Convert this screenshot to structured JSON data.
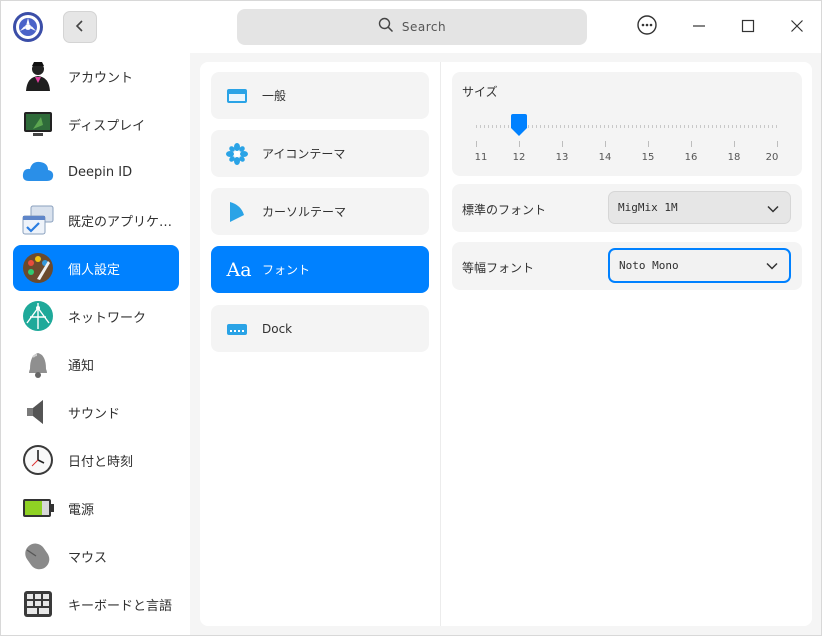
{
  "titlebar": {
    "search_placeholder": "Search"
  },
  "sidebar": {
    "items": [
      {
        "label": "アカウント",
        "icon": "account-icon"
      },
      {
        "label": "ディスプレイ",
        "icon": "display-icon"
      },
      {
        "label": "Deepin ID",
        "icon": "cloud-icon"
      },
      {
        "label": "既定のアプリケ…",
        "icon": "default-apps-icon"
      },
      {
        "label": "個人設定",
        "icon": "personalization-icon",
        "active": true
      },
      {
        "label": "ネットワーク",
        "icon": "network-icon"
      },
      {
        "label": "通知",
        "icon": "bell-icon"
      },
      {
        "label": "サウンド",
        "icon": "speaker-icon"
      },
      {
        "label": "日付と時刻",
        "icon": "clock-icon"
      },
      {
        "label": "電源",
        "icon": "battery-icon"
      },
      {
        "label": "マウス",
        "icon": "mouse-icon"
      },
      {
        "label": "キーボードと言語",
        "icon": "keyboard-icon"
      }
    ]
  },
  "submenu": {
    "items": [
      {
        "label": "一般",
        "icon": "window-icon"
      },
      {
        "label": "アイコンテーマ",
        "icon": "icon-theme-icon"
      },
      {
        "label": "カーソルテーマ",
        "icon": "cursor-icon"
      },
      {
        "label": "フォント",
        "icon": "font-icon",
        "active": true,
        "icon_text": "Aa"
      },
      {
        "label": "Dock",
        "icon": "dock-icon"
      }
    ]
  },
  "fonts": {
    "size_label": "サイズ",
    "size_ticks": [
      "11",
      "12",
      "13",
      "14",
      "15",
      "16",
      "18",
      "20"
    ],
    "size_value": "12",
    "standard_font_label": "標準のフォント",
    "standard_font_value": "MigMix 1M",
    "mono_font_label": "等幅フォント",
    "mono_font_value": "Noto Mono"
  },
  "colors": {
    "accent": "#0081ff",
    "panel_bg": "#f4f4f4",
    "window_bg": "#f5f5f5"
  }
}
